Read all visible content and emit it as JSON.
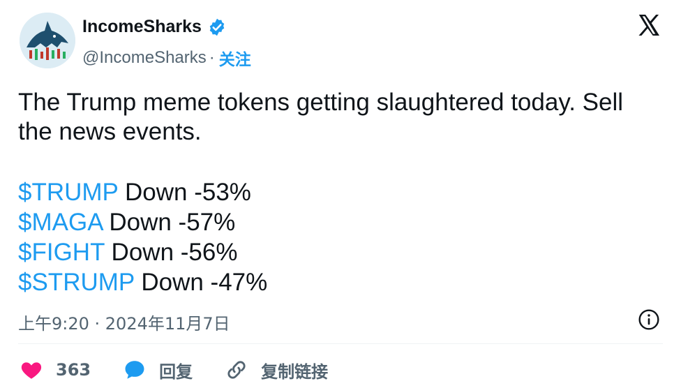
{
  "author": {
    "display_name": "IncomeSharks",
    "handle": "@IncomeSharks",
    "separator": "·",
    "follow_label": "关注"
  },
  "tweet": {
    "text": "The Trump meme tokens getting slaughtered today. Sell the news events.",
    "lines": [
      {
        "ticker": "$TRUMP",
        "change": " Down -53%"
      },
      {
        "ticker": "$MAGA",
        "change": " Down -57%"
      },
      {
        "ticker": "$FIGHT",
        "change": " Down -56%"
      },
      {
        "ticker": "$STRUMP",
        "change": " Down -47%"
      }
    ],
    "timestamp": "上午9:20 · 2024年11月7日"
  },
  "actions": {
    "like_count": "363",
    "reply_label": "回复",
    "copy_link_label": "复制链接"
  },
  "icons": {
    "logo": "x-logo-icon",
    "verified": "verified-badge-icon",
    "info": "info-icon",
    "like": "heart-icon",
    "reply": "reply-bubble-icon",
    "link": "link-icon"
  },
  "colors": {
    "accent": "#1d9bf0",
    "like": "#f91880",
    "text": "#0f1419",
    "muted": "#536471"
  }
}
